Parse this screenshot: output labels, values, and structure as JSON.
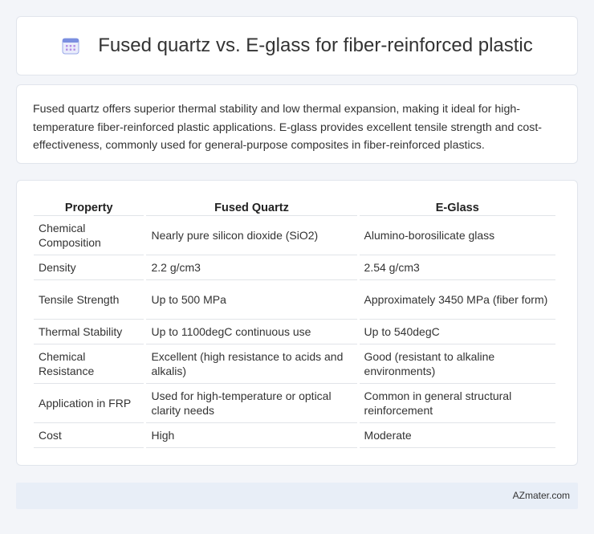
{
  "header": {
    "icon": "calendar-grid-icon",
    "title": "Fused quartz vs. E-glass for fiber-reinforced plastic"
  },
  "summary": {
    "text": "Fused quartz offers superior thermal stability and low thermal expansion, making it ideal for high-temperature fiber-reinforced plastic applications. E-glass provides excellent tensile strength and cost-effectiveness, commonly used for general-purpose composites in fiber-reinforced plastics."
  },
  "table": {
    "headers": [
      "Property",
      "Fused Quartz",
      "E-Glass"
    ],
    "rows": [
      [
        "Chemical Composition",
        "Nearly pure silicon dioxide (SiO2)",
        "Alumino-borosilicate glass"
      ],
      [
        "Density",
        "2.2 g/cm3",
        "2.54 g/cm3"
      ],
      [
        "Tensile Strength",
        "Up to 500 MPa",
        "Approximately 3450 MPa (fiber form)"
      ],
      [
        "Thermal Stability",
        "Up to 1100degC continuous use",
        "Up to 540degC"
      ],
      [
        "Chemical Resistance",
        "Excellent (high resistance to acids and alkalis)",
        "Good (resistant to alkaline environments)"
      ],
      [
        "Application in FRP",
        "Used for high-temperature or optical clarity needs",
        "Common in general structural reinforcement"
      ],
      [
        "Cost",
        "High",
        "Moderate"
      ]
    ]
  },
  "footer": {
    "brand": "AZmater.com"
  },
  "colors": {
    "icon_accent": "#7b8fe0",
    "background": "#f3f5f9",
    "footer_bg": "#e8eef7"
  }
}
